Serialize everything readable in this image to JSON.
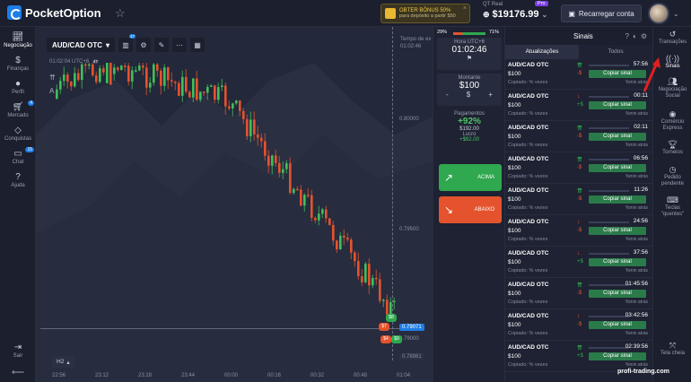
{
  "header": {
    "logo_text": "PocketOption",
    "bonus_line1": "OBTER BÔNUS 50%",
    "bonus_line2": "para depósito a partir $50",
    "account_label": "QT Real",
    "pro_badge": "Pro",
    "balance": "$19176.99",
    "recharge_label": "Recarregar conta"
  },
  "leftnav": {
    "items": [
      {
        "label": "Negociação",
        "icon": "chart-icon"
      },
      {
        "label": "Finanças",
        "icon": "dollar-icon"
      },
      {
        "label": "Perfil",
        "icon": "user-icon"
      },
      {
        "label": "Mercado",
        "icon": "cart-icon",
        "badge": "4"
      },
      {
        "label": "Conquistas",
        "icon": "diamond-icon"
      },
      {
        "label": "Chat",
        "icon": "chat-icon",
        "badge": "15"
      },
      {
        "label": "Ajuda",
        "icon": "help-icon"
      },
      {
        "label": "Sair",
        "icon": "logout-icon"
      }
    ]
  },
  "chart": {
    "pair": "AUD/CAD OTC",
    "indicator_badge": "47",
    "time_label": "01:02:04 UTC+6",
    "utc_badge": "47",
    "end_label_1": "Tempo de ex",
    "end_label_2": "01:02:46",
    "price_1": "0.80000",
    "price_2": "0.79500",
    "price_current": "0.79071",
    "price_3": "0.79000",
    "price_4": "0.78981",
    "timeframe": "H2",
    "xticks": [
      "22:56",
      "23:12",
      "23:28",
      "23:44",
      "00:00",
      "00:16",
      "00:32",
      "00:48",
      "01:04"
    ],
    "coin1": "$8",
    "coin2": "$7",
    "coin3": "$4",
    "coin4": "$9"
  },
  "trade": {
    "sent_left": "29%",
    "sent_right": "71%",
    "time_label": "Hora UTC+6",
    "time_value": "01:02:46",
    "amount_label": "Montante",
    "amount_value": "$100",
    "minus": "-",
    "currency": "$",
    "plus": "+",
    "payout_label": "Pagamentos",
    "payout_pct": "+92%",
    "payout_value": "$192.00",
    "profit_label": "Lucro",
    "profit_value": "+$92.00",
    "up_label": "ACIMA",
    "down_label": "ABAIXO"
  },
  "signals": {
    "title": "Sinais",
    "tab_updates": "Atualizações",
    "tab_all": "Todos",
    "copy_label": "Copiar sinal",
    "copied_label": "Copiado: % vezes",
    "min_label": "%min atrás",
    "rows": [
      {
        "pair": "AUD/CAD OTC",
        "amount": "$100",
        "time": "57:56",
        "dir": "up",
        "delta": "-$"
      },
      {
        "pair": "AUD/CAD OTC",
        "amount": "$100",
        "time": "00:11",
        "dir": "down",
        "delta": "+$"
      },
      {
        "pair": "AUD/CAD OTC",
        "amount": "$100",
        "time": "02:11",
        "dir": "up",
        "delta": "-$"
      },
      {
        "pair": "AUD/CAD OTC",
        "amount": "$100",
        "time": "06:56",
        "dir": "up",
        "delta": "-$"
      },
      {
        "pair": "AUD/CAD OTC",
        "amount": "$100",
        "time": "11:26",
        "dir": "up",
        "delta": "-$"
      },
      {
        "pair": "AUD/CAD OTC",
        "amount": "$100",
        "time": "24:56",
        "dir": "down",
        "delta": "-$"
      },
      {
        "pair": "AUD/CAD OTC",
        "amount": "$100",
        "time": "37:56",
        "dir": "down",
        "delta": "+$"
      },
      {
        "pair": "AUD/CAD OTC",
        "amount": "$100",
        "time": "01:45:56",
        "dir": "up",
        "delta": "-$"
      },
      {
        "pair": "AUD/CAD OTC",
        "amount": "$100",
        "time": "03:42:56",
        "dir": "down",
        "delta": "-$"
      },
      {
        "pair": "AUD/CAD OTC",
        "amount": "$100",
        "time": "02:39:56",
        "dir": "up",
        "delta": "+$"
      }
    ]
  },
  "rightnav": {
    "items": [
      {
        "label": "Transações",
        "icon": "history-icon"
      },
      {
        "label": "Sinais",
        "icon": "signal-icon"
      },
      {
        "label": "Negociação Social",
        "icon": "social-icon"
      },
      {
        "label": "Comércio Express",
        "icon": "express-icon"
      },
      {
        "label": "Torneios",
        "icon": "trophy-icon"
      },
      {
        "label": "Pedido pendente",
        "icon": "pending-icon"
      },
      {
        "label": "Teclas \"quentes\"",
        "icon": "keyboard-icon"
      },
      {
        "label": "Tela cheia",
        "icon": "fullscreen-icon"
      }
    ]
  },
  "watermark": "profi-trading.com",
  "colors": {
    "up": "#2fa84f",
    "down": "#e4532d",
    "accent": "#1f7de6"
  }
}
